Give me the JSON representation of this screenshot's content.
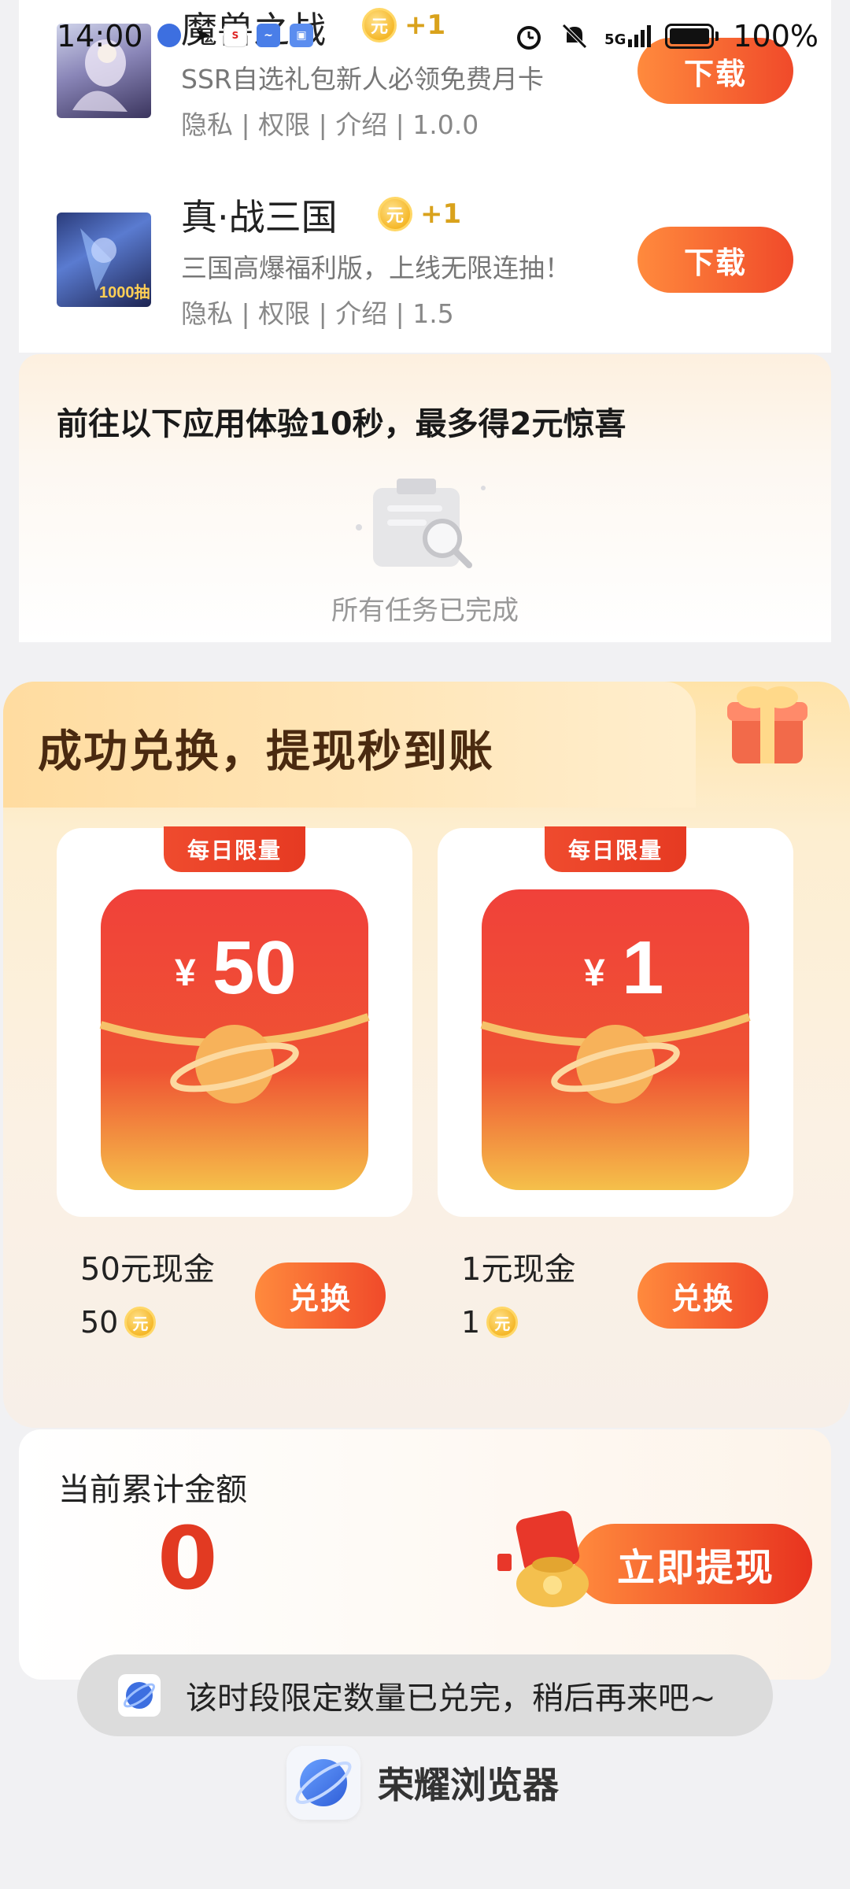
{
  "status_bar": {
    "time": "14:00",
    "battery": "100%",
    "signal_label": "5G"
  },
  "apps": [
    {
      "name": "魔兽之战",
      "reward": "+1",
      "coin_char": "元",
      "desc": "SSR自选礼包新人必领免费月卡",
      "links": "隐私 | 权限 | 介绍 | 1.0.0",
      "button": "下载"
    },
    {
      "name": "真·战三国",
      "reward": "+1",
      "coin_char": "元",
      "desc": "三国高爆福利版，上线无限连抽！",
      "links": "隐私 | 权限 | 介绍 | 1.5",
      "button": "下载",
      "icon_badge": "1000抽"
    }
  ],
  "experience": {
    "title": "前往以下应用体验10秒，最多得2元惊喜",
    "empty_text": "所有任务已完成"
  },
  "exchange": {
    "title": "成功兑换，提现秒到账",
    "packs": [
      {
        "tag": "每日限量",
        "amount": "50",
        "currency": "¥",
        "label": "50元现金",
        "cost": "50",
        "coin_char": "元",
        "button": "兑换"
      },
      {
        "tag": "每日限量",
        "amount": "1",
        "currency": "¥",
        "label": "1元现金",
        "cost": "1",
        "coin_char": "元",
        "button": "兑换"
      }
    ]
  },
  "total": {
    "label": "当前累计金额",
    "value": "0",
    "button": "立即提现"
  },
  "toast": {
    "text": "该时段限定数量已兑完，稍后再来吧~"
  },
  "brand": {
    "name": "荣耀浏览器"
  },
  "colors": {
    "accent_orange": "#f3632f",
    "accent_red": "#e23a22",
    "coin_gold": "#f5b82a"
  }
}
